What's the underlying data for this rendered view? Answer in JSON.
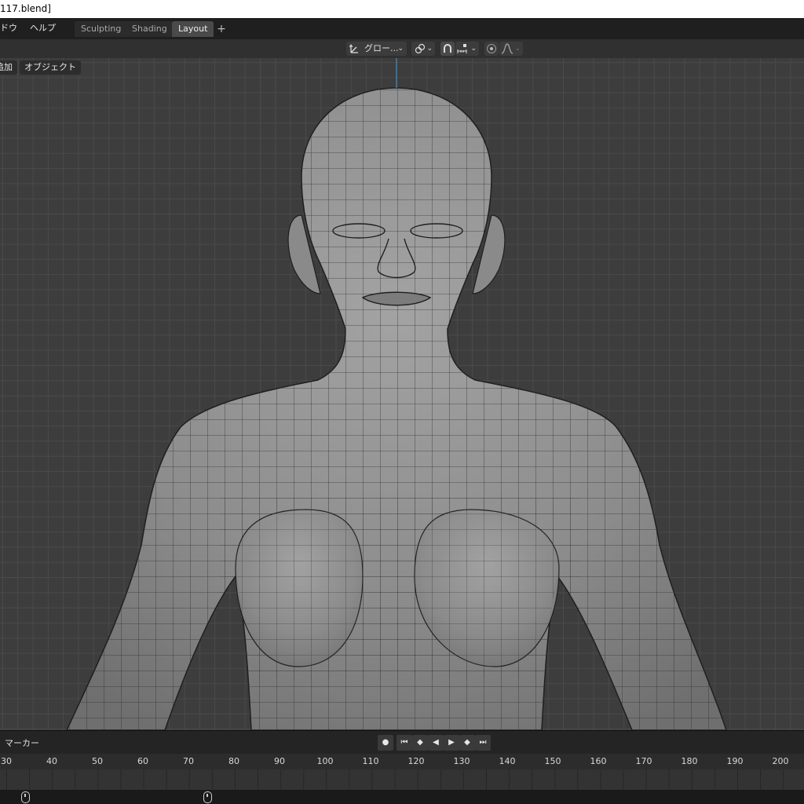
{
  "window": {
    "title": "117.blend]"
  },
  "menubar": {
    "items": [
      "ドウ",
      "ヘルプ"
    ]
  },
  "workspaces": {
    "tabs": [
      "Sculpting",
      "Shading",
      "Layout"
    ],
    "active": "Layout",
    "add_label": "+"
  },
  "viewport_header": {
    "transform_orientation": "グロー...",
    "add_menu": "追加",
    "object_menu": "オブジェクト"
  },
  "timeline": {
    "marker_label": "マーカー",
    "frames": [
      "30",
      "40",
      "50",
      "60",
      "70",
      "80",
      "90",
      "100",
      "110",
      "120",
      "130",
      "140",
      "150",
      "160",
      "170",
      "180",
      "190",
      "200"
    ]
  },
  "colors": {
    "accent": "#4772b3",
    "viewport_bg": "#3d3d3d",
    "mesh_surface": "#8a8a8a"
  },
  "icons": [
    "transform-orientation-icon",
    "pivot-icon",
    "snap-icon",
    "snap-increment-icon",
    "proportional-edit-icon",
    "falloff-icon",
    "record-icon",
    "jump-start-icon",
    "keyframe-prev-icon",
    "play-reverse-icon",
    "play-icon",
    "keyframe-next-icon",
    "jump-end-icon",
    "mouse-icon"
  ]
}
